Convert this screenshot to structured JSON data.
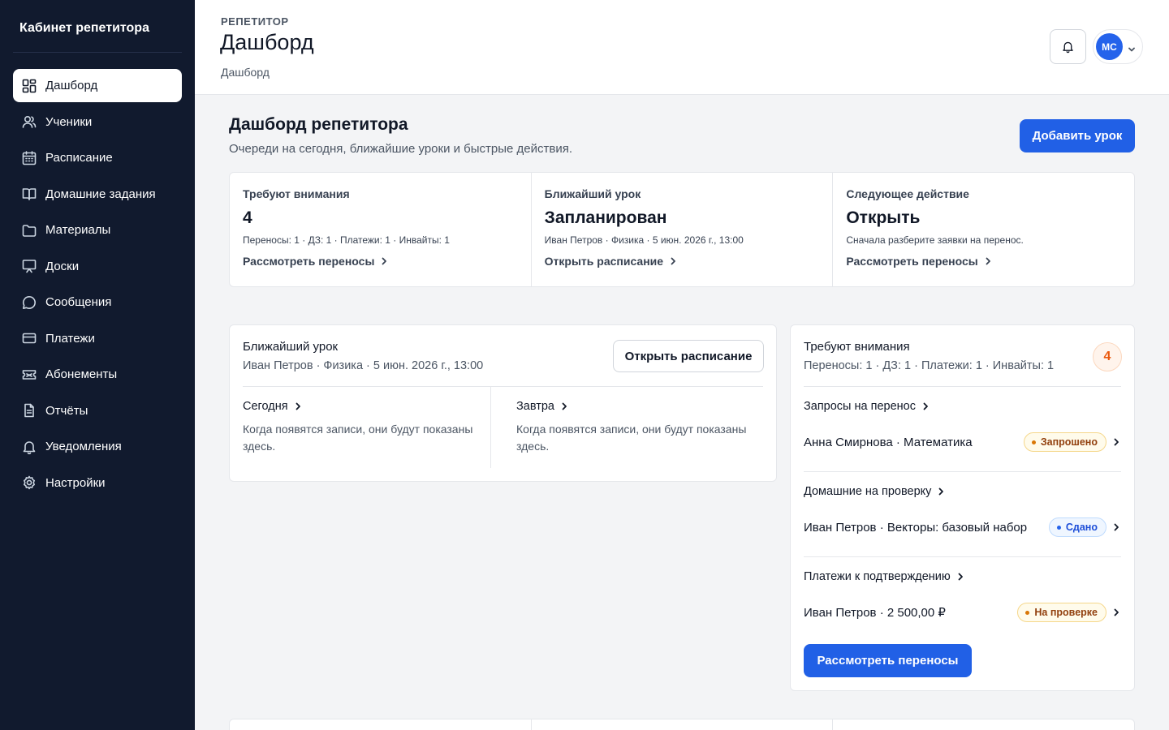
{
  "sidebar": {
    "brand": "Кабинет репетитора",
    "items": [
      {
        "label": "Дашборд",
        "icon": "dashboard-icon"
      },
      {
        "label": "Ученики",
        "icon": "users-icon"
      },
      {
        "label": "Расписание",
        "icon": "calendar-icon"
      },
      {
        "label": "Домашние задания",
        "icon": "book-icon"
      },
      {
        "label": "Материалы",
        "icon": "folder-icon"
      },
      {
        "label": "Доски",
        "icon": "board-icon"
      },
      {
        "label": "Сообщения",
        "icon": "message-icon"
      },
      {
        "label": "Платежи",
        "icon": "card-icon"
      },
      {
        "label": "Абонементы",
        "icon": "ticket-icon"
      },
      {
        "label": "Отчёты",
        "icon": "report-icon"
      },
      {
        "label": "Уведомления",
        "icon": "bell-icon"
      },
      {
        "label": "Настройки",
        "icon": "gear-icon"
      }
    ]
  },
  "header": {
    "eyebrow": "РЕПЕТИТОР",
    "title": "Дашборд",
    "breadcrumb": "Дашборд",
    "avatar_initials": "МС"
  },
  "main": {
    "title": "Дашборд репетитора",
    "subtitle": "Очереди на сегодня, ближайшие уроки и быстрые действия.",
    "add_button": "Добавить урок"
  },
  "summary": [
    {
      "label": "Требуют внимания",
      "value": "4",
      "detail": "Переносы: 1 · ДЗ: 1 · Платежи: 1 · Инвайты: 1",
      "link": "Рассмотреть переносы"
    },
    {
      "label": "Ближайший урок",
      "value": "Запланирован",
      "detail": "Иван Петров · Физика · 5 июн. 2026 г., 13:00",
      "link": "Открыть расписание"
    },
    {
      "label": "Следующее действие",
      "value": "Открыть",
      "detail": "Сначала разберите заявки на перенос.",
      "link": "Рассмотреть переносы"
    }
  ],
  "lesson": {
    "title": "Ближайший урок",
    "subtitle": "Иван Петров · Физика · 5 июн. 2026 г., 13:00",
    "button": "Открыть расписание",
    "today": {
      "label": "Сегодня",
      "empty": "Когда появятся записи, они будут показаны здесь."
    },
    "tomorrow": {
      "label": "Завтра",
      "empty": "Когда появятся записи, они будут показаны здесь."
    }
  },
  "attention": {
    "title": "Требуют внимания",
    "subtitle": "Переносы: 1 · ДЗ: 1 · Платежи: 1 · Инвайты: 1",
    "count": "4",
    "groups": [
      {
        "label": "Запросы на перенос",
        "row": "Анна Смирнова · Математика",
        "status": "Запрошено"
      },
      {
        "label": "Домашние на проверку",
        "row": "Иван Петров · Векторы: базовый набор",
        "status": "Сдано"
      },
      {
        "label": "Платежи к подтверждению",
        "row": "Иван Петров · 2 500,00 ₽",
        "status": "На проверке"
      }
    ],
    "button": "Рассмотреть переносы"
  },
  "colors": {
    "sidebar_bg": "#111a2e",
    "accent": "#2160e6",
    "warn": "#d97706",
    "info": "#2563eb"
  }
}
